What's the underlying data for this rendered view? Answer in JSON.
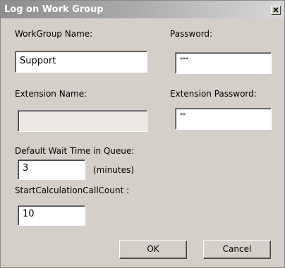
{
  "window": {
    "title": "Log on Work Group",
    "close_icon": "close-icon"
  },
  "form": {
    "workgroup_name_label": "WorkGroup Name:",
    "workgroup_name_value": "Support",
    "password_label": "Password:",
    "password_value": "***",
    "extension_name_label": "Extension Name:",
    "extension_name_value": "",
    "extension_password_label": "Extension Password:",
    "extension_password_value": "**",
    "wait_time_label": "Default Wait Time in Queue:",
    "wait_time_value": "3",
    "wait_time_unit": "(minutes)",
    "call_count_label": "StartCalculationCallCount :",
    "call_count_value": "10"
  },
  "buttons": {
    "ok_label": "OK",
    "cancel_label": "Cancel"
  },
  "colors": {
    "dialog_background": "#d4d0c8",
    "title_text": "#ffffff",
    "disabled_field": "#ece9e4"
  }
}
